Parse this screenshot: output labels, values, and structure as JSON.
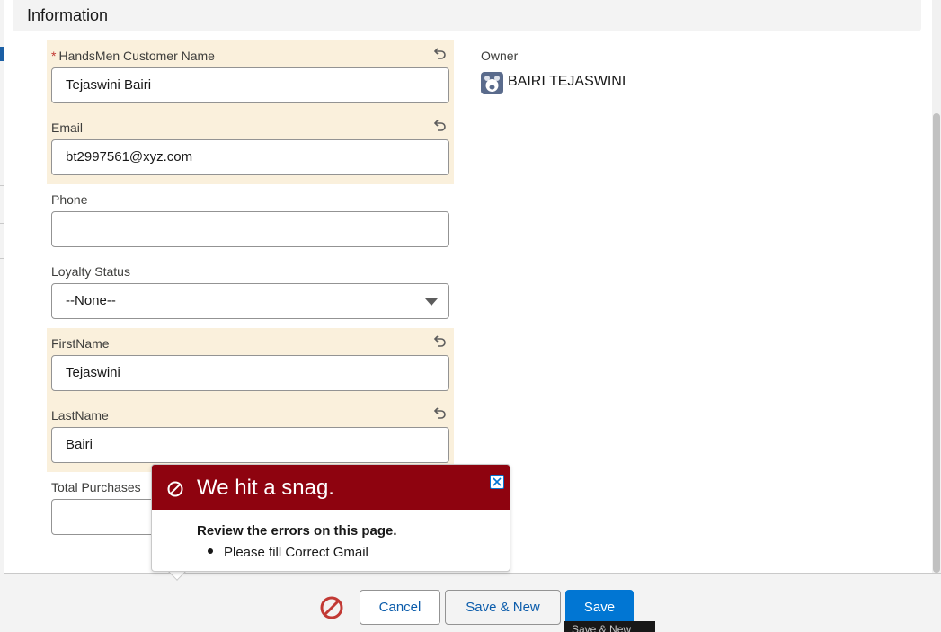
{
  "section": {
    "title": "Information"
  },
  "fields": {
    "customer_name": {
      "label": "HandsMen Customer Name",
      "required_mark": "*",
      "value": "Tejaswini Bairi"
    },
    "email": {
      "label": "Email",
      "value": "bt2997561@xyz.com"
    },
    "phone": {
      "label": "Phone",
      "value": ""
    },
    "loyalty_status": {
      "label": "Loyalty Status",
      "value": "--None--"
    },
    "first_name": {
      "label": "FirstName",
      "value": "Tejaswini"
    },
    "last_name": {
      "label": "LastName",
      "value": "Bairi"
    },
    "total_purchases": {
      "label": "Total Purchases",
      "value": ""
    }
  },
  "owner": {
    "label": "Owner",
    "name": "BAIRI TEJASWINI"
  },
  "error_popover": {
    "title": "We hit a snag.",
    "subtitle": "Review the errors on this page.",
    "items": [
      "Please fill Correct Gmail"
    ]
  },
  "footer": {
    "cancel_label": "Cancel",
    "save_new_label": "Save & New",
    "save_label": "Save",
    "tooltip": "Save & New"
  },
  "colors": {
    "changed_field_bg": "#faf0dc",
    "error_header": "#8e030f",
    "brand_button": "#0176d3",
    "error_icon": "#c23934"
  },
  "icons": [
    "undo-icon",
    "owner-avatar-icon",
    "ban-icon",
    "close-icon",
    "chevron-down-icon"
  ]
}
